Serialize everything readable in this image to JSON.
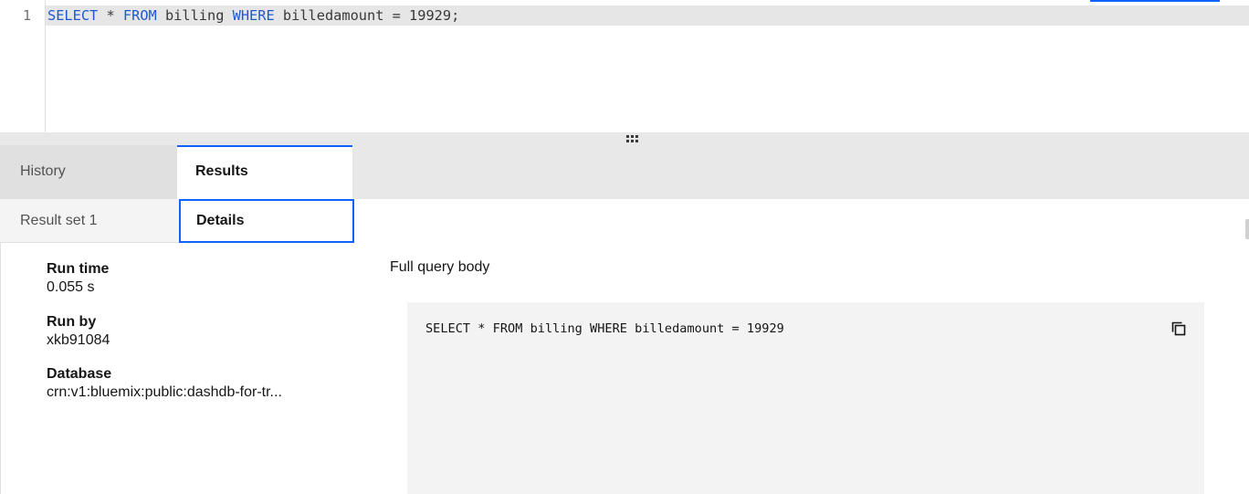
{
  "editor": {
    "line_number": "1",
    "code": {
      "kw_select": "SELECT",
      "star": " * ",
      "kw_from": "FROM",
      "table": " billing ",
      "kw_where": "WHERE",
      "condition": " billedamount = 19929;"
    }
  },
  "tabs": [
    {
      "label": "History",
      "active": false
    },
    {
      "label": "Results",
      "active": true
    }
  ],
  "subtabs": [
    {
      "label": "Result set 1",
      "active": false
    },
    {
      "label": "Details",
      "active": true
    }
  ],
  "details": {
    "run_time_label": "Run time",
    "run_time_value": "0.055 s",
    "run_by_label": "Run by",
    "run_by_value": "xkb91084",
    "database_label": "Database",
    "database_value": "crn:v1:bluemix:public:dashdb-for-tr...",
    "full_query_label": "Full query body",
    "full_query": "SELECT * FROM billing WHERE billedamount = 19929"
  },
  "icons": {
    "copy": "copy-icon",
    "drag_handle": "drag-handle-icon"
  },
  "colors": {
    "accent": "#0f62fe",
    "keyword": "#1f59d1"
  }
}
